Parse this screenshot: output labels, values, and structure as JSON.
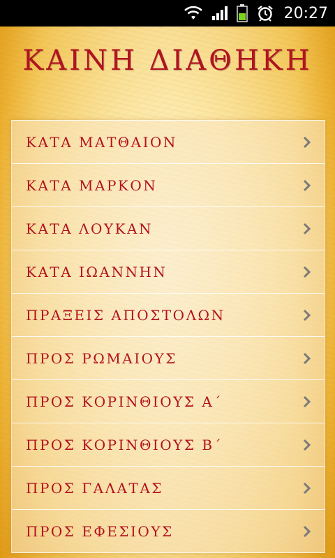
{
  "status_bar": {
    "time": "20:27",
    "icons": [
      "wifi-icon",
      "signal-icon",
      "battery-icon",
      "alarm-icon"
    ]
  },
  "app": {
    "title": "ΚΑΙΝΗ  ΔΙΑΘΗΚΗ"
  },
  "books": [
    {
      "label": "ΚΑΤΑ ΜΑΤΘΑΙΟΝ",
      "icon": "chevron-right-icon"
    },
    {
      "label": "ΚΑΤΑ ΜΑΡΚΟΝ",
      "icon": "chevron-right-icon"
    },
    {
      "label": "ΚΑΤΑ ΛΟΥΚΑΝ",
      "icon": "chevron-right-icon"
    },
    {
      "label": "ΚΑΤΑ ΙΩΑΝΝΗΝ",
      "icon": "chevron-right-icon"
    },
    {
      "label": "ΠΡΑΞΕΙΣ ΑΠΟΣΤΟΛΩΝ",
      "icon": "chevron-right-icon"
    },
    {
      "label": "ΠΡΟΣ ΡΩΜΑΙΟΥΣ",
      "icon": "chevron-right-icon"
    },
    {
      "label": "ΠΡΟΣ ΚΟΡΙΝΘΙΟΥΣ Α΄",
      "icon": "chevron-right-icon"
    },
    {
      "label": "ΠΡΟΣ ΚΟΡΙΝΘΙΟΥΣ Β΄",
      "icon": "chevron-right-icon"
    },
    {
      "label": "ΠΡΟΣ ΓΑΛΑΤΑΣ",
      "icon": "chevron-right-icon"
    },
    {
      "label": "ΠΡΟΣ ΕΦΕΣΙΟΥΣ",
      "icon": "chevron-right-icon"
    }
  ],
  "colors": {
    "title": "#b01422",
    "item_text": "#b3121e",
    "chevron": "#7a7a7a",
    "battery_fill": "#7bd321"
  }
}
